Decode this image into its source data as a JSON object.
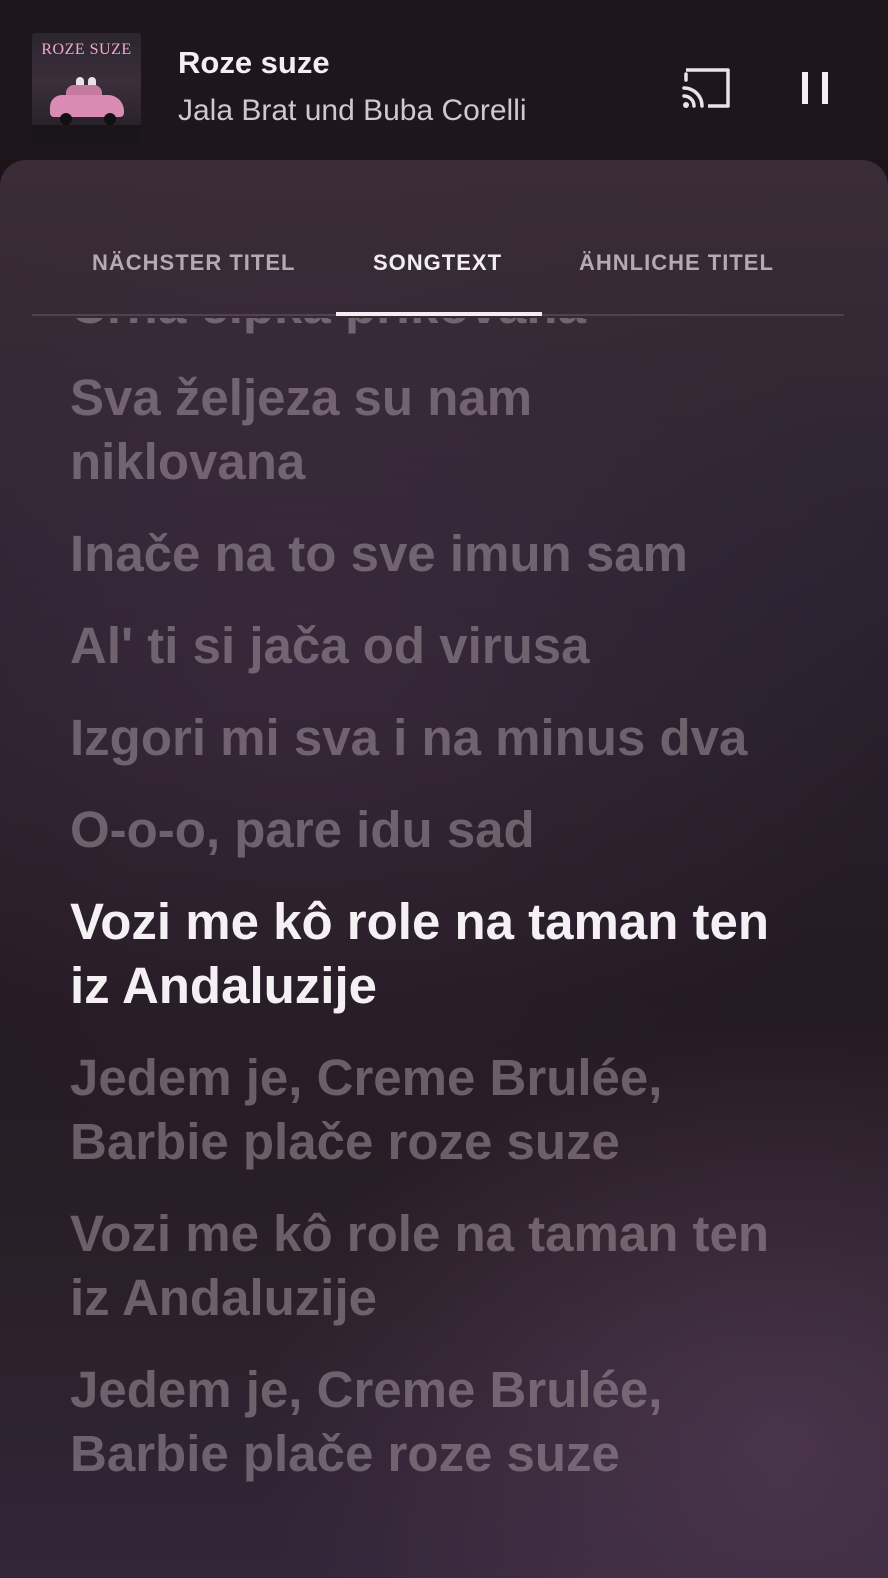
{
  "now_playing": {
    "album_art_title": "ROZE SUZE",
    "title": "Roze suze",
    "artist": "Jala Brat und Buba Corelli"
  },
  "controls": {
    "cast_icon": "cast-icon",
    "pause_icon": "pause-icon"
  },
  "tabs": [
    {
      "label": "NÄCHSTER TITEL",
      "active": false
    },
    {
      "label": "SONGTEXT",
      "active": true
    },
    {
      "label": "ÄHNLICHE TITEL",
      "active": false
    }
  ],
  "lyrics": [
    {
      "text": "Crna čipka prikovana",
      "current": false
    },
    {
      "text": "Sva željeza su nam niklovana",
      "current": false
    },
    {
      "text": "Inače na to sve imun sam",
      "current": false
    },
    {
      "text": "Al' ti si jača od virusa",
      "current": false
    },
    {
      "text": "Izgori mi sva i na minus dva",
      "current": false
    },
    {
      "text": "O-o-o, pare idu sad",
      "current": false
    },
    {
      "text": "Vozi me kô role na taman ten iz Andaluzije",
      "current": true
    },
    {
      "text": "Jedem je, Creme Brulée, Barbie plače roze suze",
      "current": false
    },
    {
      "text": "Vozi me kô role na taman ten iz Andaluzije",
      "current": false
    },
    {
      "text": "Jedem je, Creme Brulée, Barbie plače roze suze",
      "current": false
    }
  ],
  "colors": {
    "background": "#1c1419",
    "active_text": "#f4f0f3",
    "inactive_lyric": "#8a7d87",
    "tab_inactive": "#b3abb1"
  }
}
